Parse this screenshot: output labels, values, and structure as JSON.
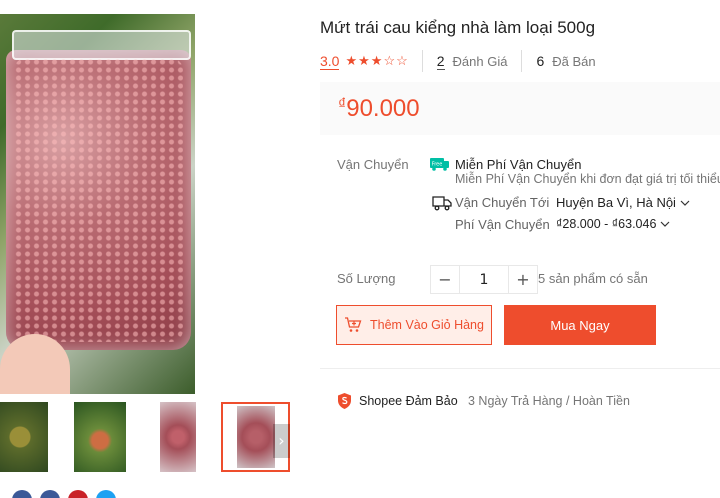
{
  "product": {
    "title": "Mứt trái cau kiểng nhà làm loại 500g",
    "rating": "3.0",
    "stars_filled": 3,
    "stars_total": 5,
    "review_count": "2",
    "review_label": "Đánh Giá",
    "sold_count": "6",
    "sold_label": "Đã Bán",
    "price_currency": "₫",
    "price_value": "90.000"
  },
  "shipping": {
    "label": "Vận Chuyển",
    "free_title": "Miễn Phí Vận Chuyển",
    "free_desc": "Miễn Phí Vận Chuyển khi đơn đạt giá trị tối thiểu",
    "free_badge": "Free",
    "ship_to_label": "Vận Chuyển Tới",
    "ship_to_value": "Huyện Ba Vì, Hà Nội",
    "fee_label": "Phí Vận Chuyển",
    "fee_value": "₫28.000 - ₫63.046"
  },
  "quantity": {
    "label": "Số Lượng",
    "minus": "−",
    "value": "1",
    "plus": "+",
    "stock": "5 sản phẩm có sẵn"
  },
  "actions": {
    "add_to_cart": "Thêm Vào Giỏ Hàng",
    "buy_now": "Mua Ngay"
  },
  "guarantee": {
    "label": "Shopee Đảm Bảo",
    "text": "3 Ngày Trả Hàng / Hoàn Tiền"
  },
  "gallery": {
    "next_arrow": "›",
    "selected_thumbnail": 4,
    "thumbnail_count": 4
  },
  "colors": {
    "accent": "#ee4d2d",
    "price_bg": "#fafafa",
    "cart_bg": "#fff5f1"
  }
}
